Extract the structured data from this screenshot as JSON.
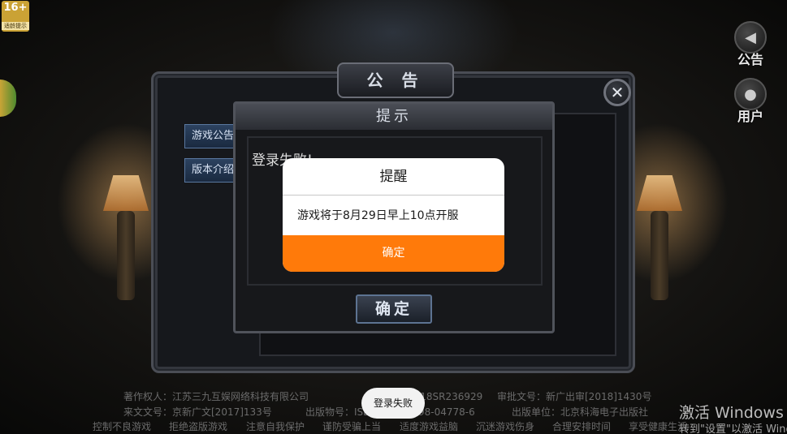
{
  "age_badge": {
    "rating": "16+",
    "note": "适龄提示"
  },
  "side_buttons": [
    {
      "label": "公告",
      "icon": "speaker-icon"
    },
    {
      "label": "用户",
      "icon": "user-icon"
    }
  ],
  "notice_panel": {
    "title": "公 告",
    "close_symbol": "✕",
    "tabs": [
      "游戏公告",
      "版本介绍"
    ]
  },
  "tip_dialog": {
    "title": "提示",
    "message": "登录失败!",
    "ok_label": "确定"
  },
  "alert": {
    "title": "提醒",
    "message": "游戏将于8月29日早上10点开服",
    "button": "确定",
    "button_color": "#ff7a0a"
  },
  "footer": {
    "line1": [
      "著作权人：江苏三九互娱网络科技有限公司",
      "登记号：2018SR236929",
      "审批文号：新广出审[2018]1430号"
    ],
    "line2": [
      "来文文号：京新广文[2017]133号",
      "出版物号：ISBN 978-7-498-04778-6",
      "出版单位：北京科海电子出版社"
    ],
    "line3": [
      "控制不良游戏",
      "拒绝盗版游戏",
      "注意自我保护",
      "谨防受骗上当",
      "适度游戏益脑",
      "沉迷游戏伤身",
      "合理安排时间",
      "享受健康生活"
    ]
  },
  "toast": "登录失败",
  "watermark": {
    "line1": "激活 Windows",
    "line2": "转到\"设置\"以激活 Windows。"
  }
}
